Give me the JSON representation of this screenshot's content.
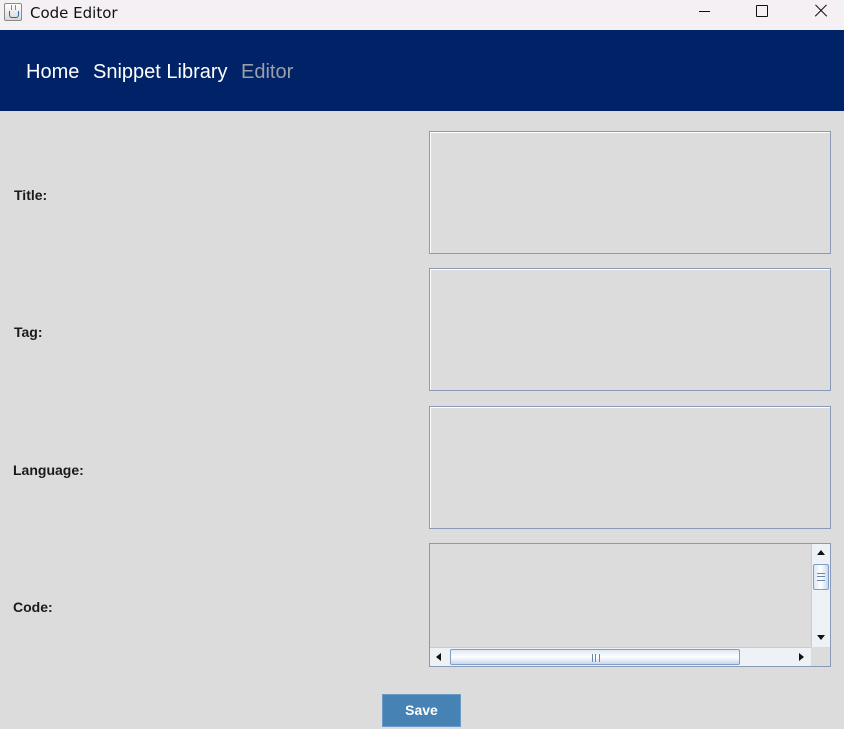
{
  "window": {
    "title": "Code Editor",
    "icon": "java-cup-icon",
    "controls": [
      "minimize-icon",
      "maximize-icon",
      "close-icon"
    ]
  },
  "nav": {
    "items": [
      {
        "label": "Home",
        "active": false
      },
      {
        "label": "Snippet Library",
        "active": false
      },
      {
        "label": "Editor",
        "active": true
      }
    ]
  },
  "form": {
    "fields": [
      {
        "label": "Title:",
        "value": ""
      },
      {
        "label": "Tag:",
        "value": ""
      },
      {
        "label": "Language:",
        "value": ""
      },
      {
        "label": "Code:",
        "value": ""
      }
    ],
    "save_label": "Save"
  },
  "colors": {
    "navbar": "#002266",
    "nav_text": "#ffffff",
    "nav_inactive_text": "#9a9fa8",
    "background": "#dcdcdc",
    "save_button": "#4682b4"
  }
}
